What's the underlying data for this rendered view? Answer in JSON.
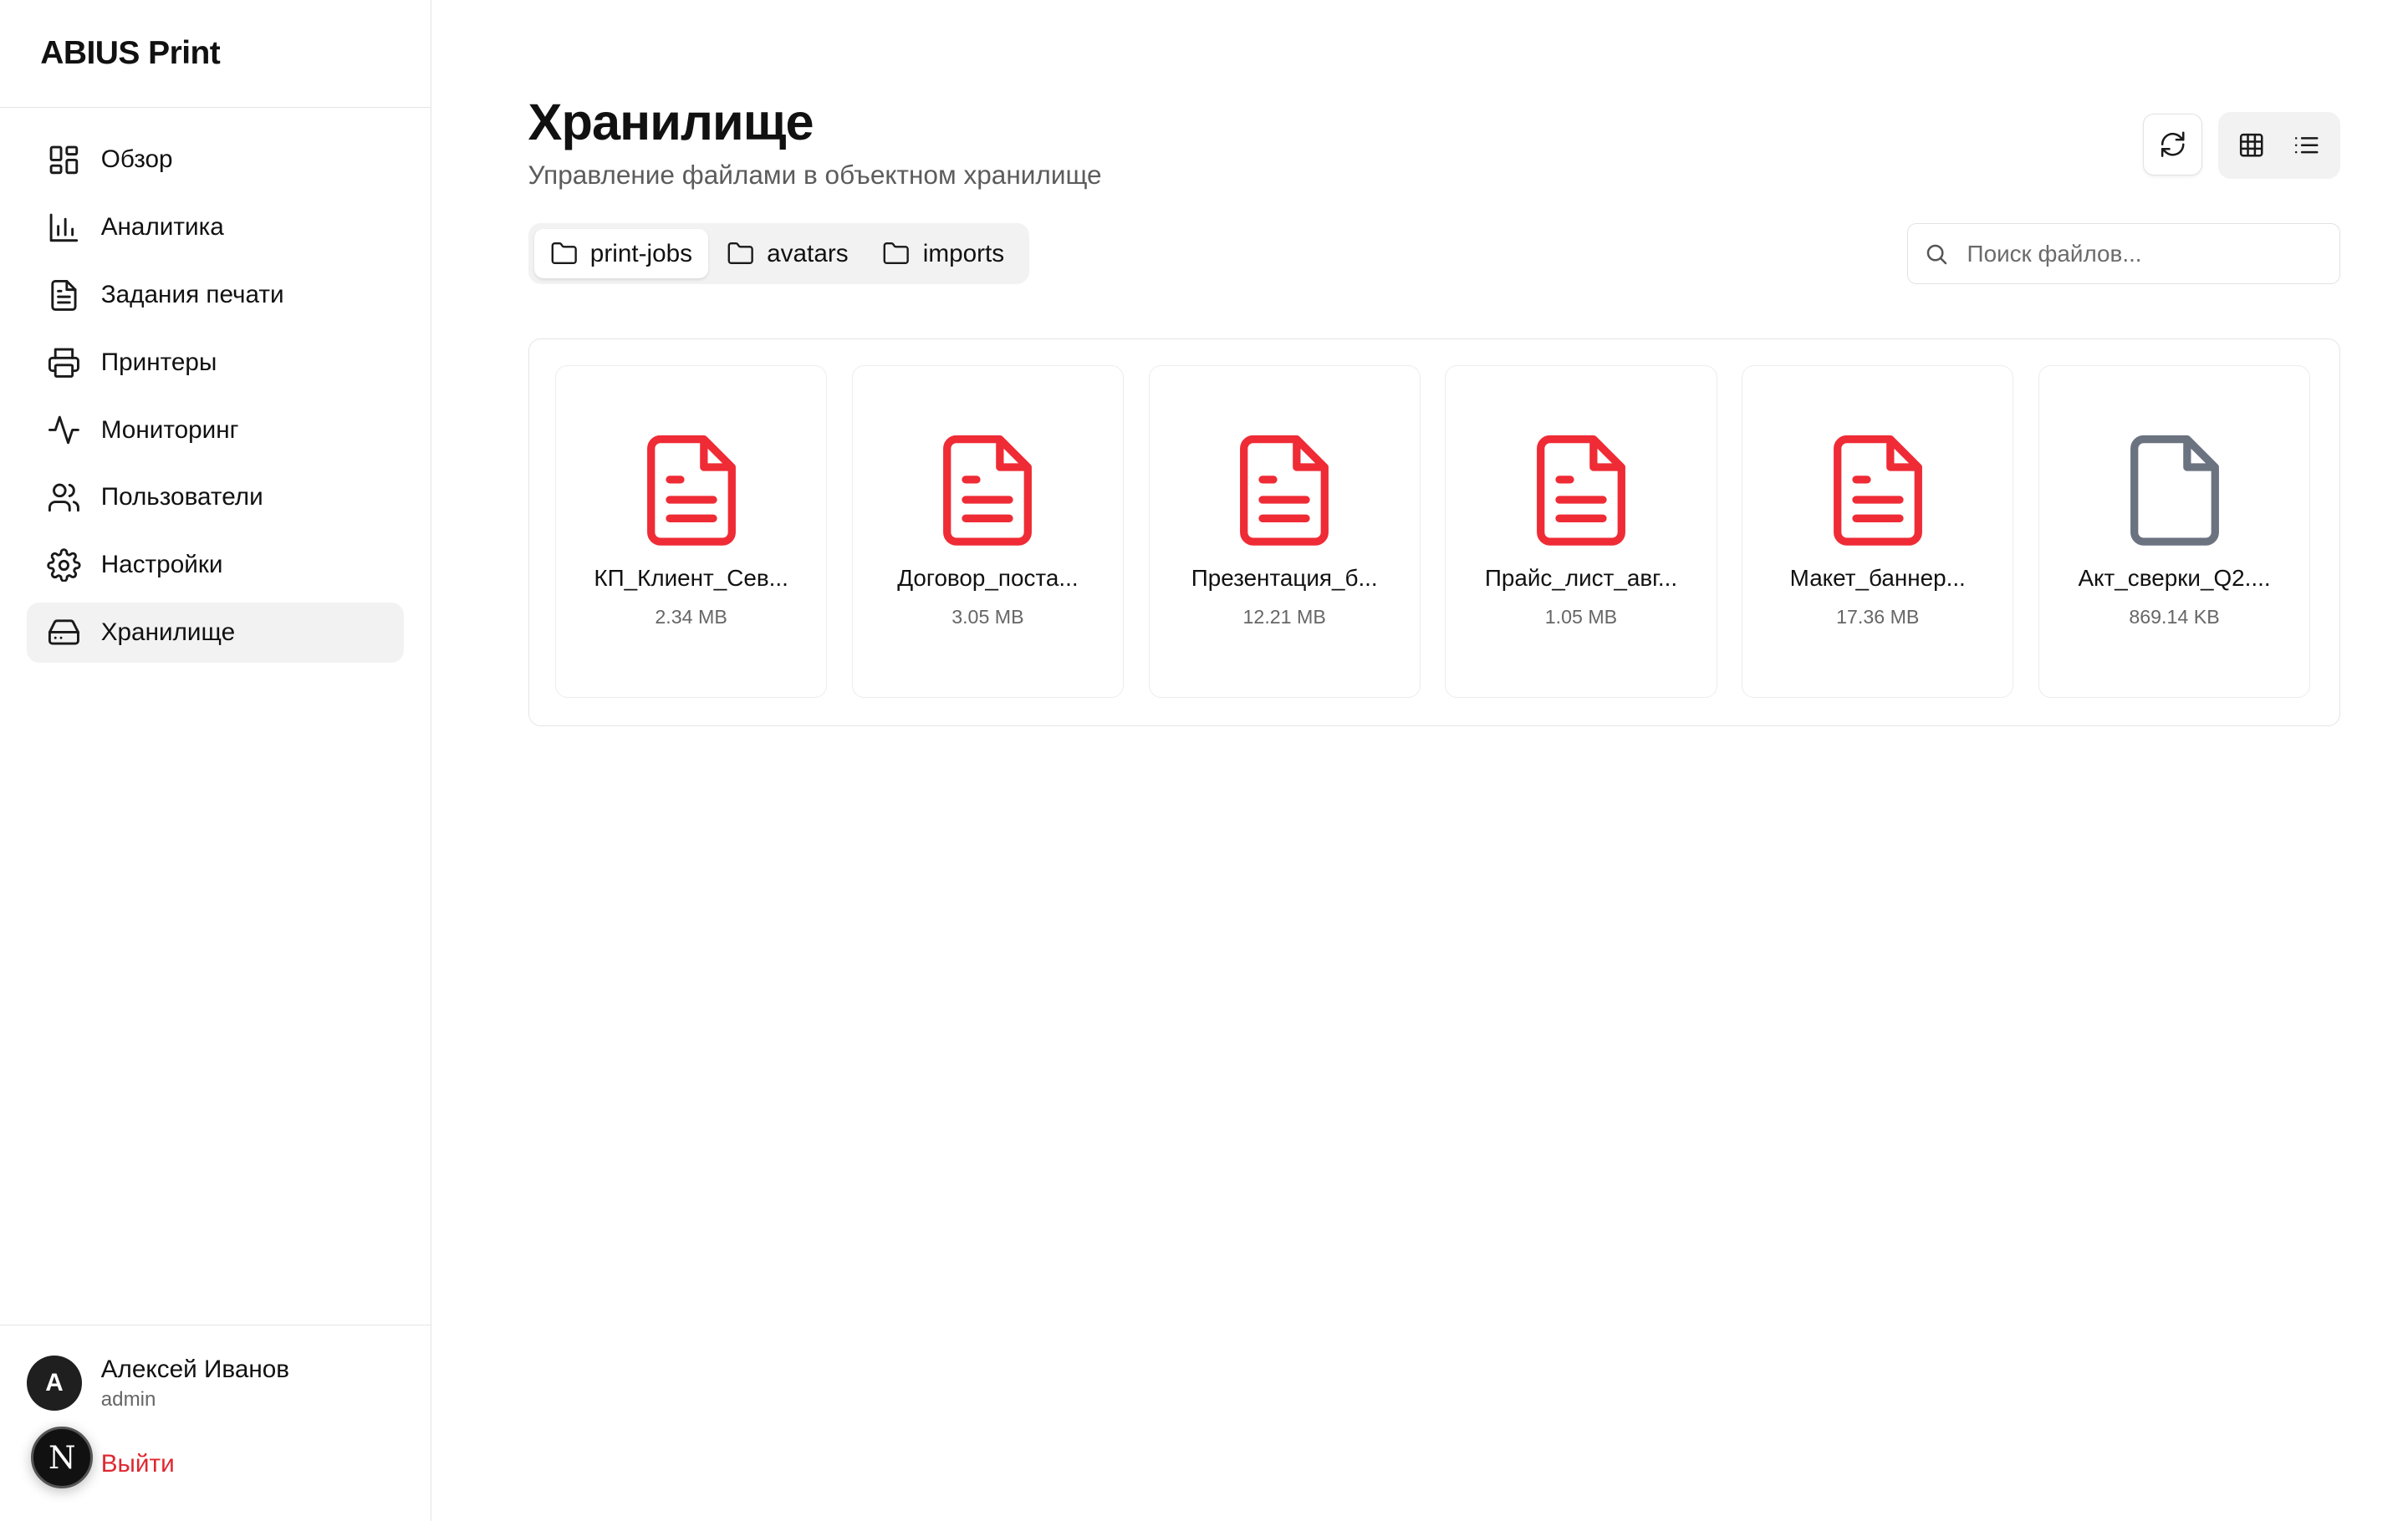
{
  "app": {
    "name": "ABIUS Print"
  },
  "sidebar": {
    "items": [
      {
        "label": "Обзор",
        "icon": "layout-dashboard-icon",
        "active": false
      },
      {
        "label": "Аналитика",
        "icon": "bar-chart-icon",
        "active": false
      },
      {
        "label": "Задания печати",
        "icon": "file-text-icon",
        "active": false
      },
      {
        "label": "Принтеры",
        "icon": "printer-icon",
        "active": false
      },
      {
        "label": "Мониторинг",
        "icon": "activity-icon",
        "active": false
      },
      {
        "label": "Пользователи",
        "icon": "users-icon",
        "active": false
      },
      {
        "label": "Настройки",
        "icon": "settings-icon",
        "active": false
      },
      {
        "label": "Хранилище",
        "icon": "hard-drive-icon",
        "active": true
      }
    ]
  },
  "user": {
    "initial": "A",
    "name": "Алексей Иванов",
    "role": "admin",
    "logout_label": "Выйти",
    "badge": "N"
  },
  "page": {
    "title": "Хранилище",
    "subtitle": "Управление файлами в объектном хранилище"
  },
  "buckets": [
    {
      "label": "print-jobs",
      "active": true
    },
    {
      "label": "avatars",
      "active": false
    },
    {
      "label": "imports",
      "active": false
    }
  ],
  "search": {
    "placeholder": "Поиск файлов..."
  },
  "files": [
    {
      "name": "КП_Клиент_Сев...",
      "size": "2.34 MB",
      "type": "pdf"
    },
    {
      "name": "Договор_поста...",
      "size": "3.05 MB",
      "type": "pdf"
    },
    {
      "name": "Презентация_б...",
      "size": "12.21 MB",
      "type": "pdf"
    },
    {
      "name": "Прайс_лист_авг...",
      "size": "1.05 MB",
      "type": "pdf"
    },
    {
      "name": "Макет_баннер...",
      "size": "17.36 MB",
      "type": "pdf"
    },
    {
      "name": "Акт_сверки_Q2....",
      "size": "869.14 KB",
      "type": "generic"
    }
  ],
  "colors": {
    "pdf": "#ef2b35",
    "generic": "#6b7280",
    "logout": "#e0272f",
    "active_bg": "#f2f2f2"
  }
}
